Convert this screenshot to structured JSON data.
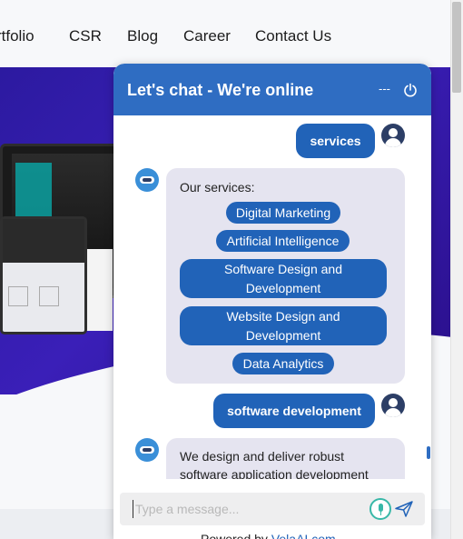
{
  "nav": {
    "items": [
      "rtfolio",
      "CSR",
      "Blog",
      "Career",
      "Contact Us"
    ]
  },
  "chat": {
    "title": "Let's chat - We're online",
    "minimize_label": "---",
    "messages": {
      "user1": "services",
      "bot_intro": "Our services:",
      "services": [
        "Digital Marketing",
        "Artificial Intelligence",
        "Software Design and Development",
        "Website Design and Development",
        "Data Analytics"
      ],
      "user2": "software development",
      "bot_reply_line1": "We design and deliver robust",
      "bot_reply_line2": "software application development"
    },
    "input_placeholder": "Type a message...",
    "powered_by_prefix": "Powered by",
    "powered_by_link": "VelaAI.com"
  },
  "colors": {
    "header": "#2f6dc2",
    "user_bubble": "#2163b8",
    "bot_bubble": "#e5e4f0",
    "hero": "#3a1fb8"
  },
  "icons": [
    "power-icon",
    "user-avatar-icon",
    "bot-icon",
    "mic-icon",
    "send-icon"
  ]
}
